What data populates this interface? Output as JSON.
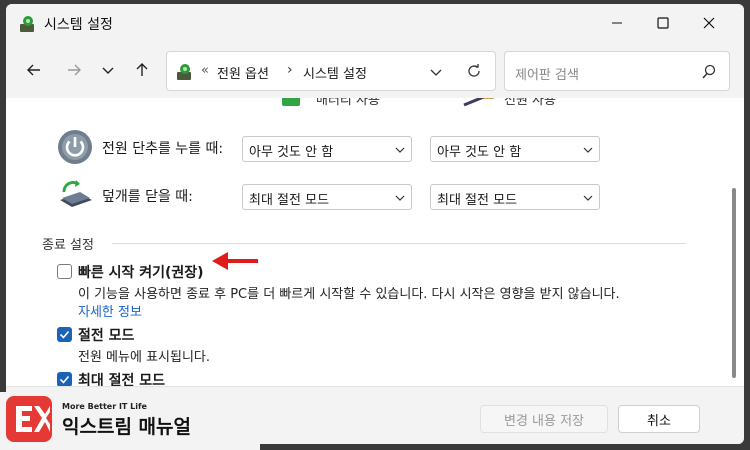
{
  "window": {
    "title": "시스템 설정"
  },
  "navigation": {
    "breadcrumb_prefix": "«",
    "breadcrumbs": [
      "전원 옵션",
      "시스템 설정"
    ],
    "breadcrumb_separator": "›",
    "search_placeholder": "제어판 검색"
  },
  "content": {
    "cut_off_labels": [
      "배터리 사용",
      "전원 사용"
    ],
    "power_button": {
      "label": "전원 단추를 누를 때:",
      "battery_value": "아무 것도 안 함",
      "plugged_value": "아무 것도 안 함"
    },
    "lid": {
      "label": "덮개를 닫을 때:",
      "battery_value": "최대 절전 모드",
      "plugged_value": "최대 절전 모드"
    },
    "shutdown_settings": {
      "group_label": "종료 설정",
      "fast_startup": {
        "label": "빠른 시작 켜기(권장)",
        "checked": false,
        "description": "이 기능을 사용하면 종료 후 PC를 더 빠르게 시작할 수 있습니다. 다시 시작은 영향을 받지 않습니다.",
        "link": "자세한 정보"
      },
      "sleep": {
        "label": "절전 모드",
        "checked": true,
        "description": "전원 메뉴에 표시됩니다."
      },
      "hibernate": {
        "label": "최대 절전 모드",
        "checked": true
      }
    }
  },
  "footer": {
    "save_label": "변경 내용 저장",
    "cancel_label": "취소"
  },
  "watermark": {
    "tagline": "More Better IT Life",
    "brand": "익스트림 매뉴얼"
  },
  "colors": {
    "accent": "#1a63b8",
    "link": "#1a63c8",
    "annotation_arrow": "#e01b1b",
    "brand": "#e53935"
  }
}
